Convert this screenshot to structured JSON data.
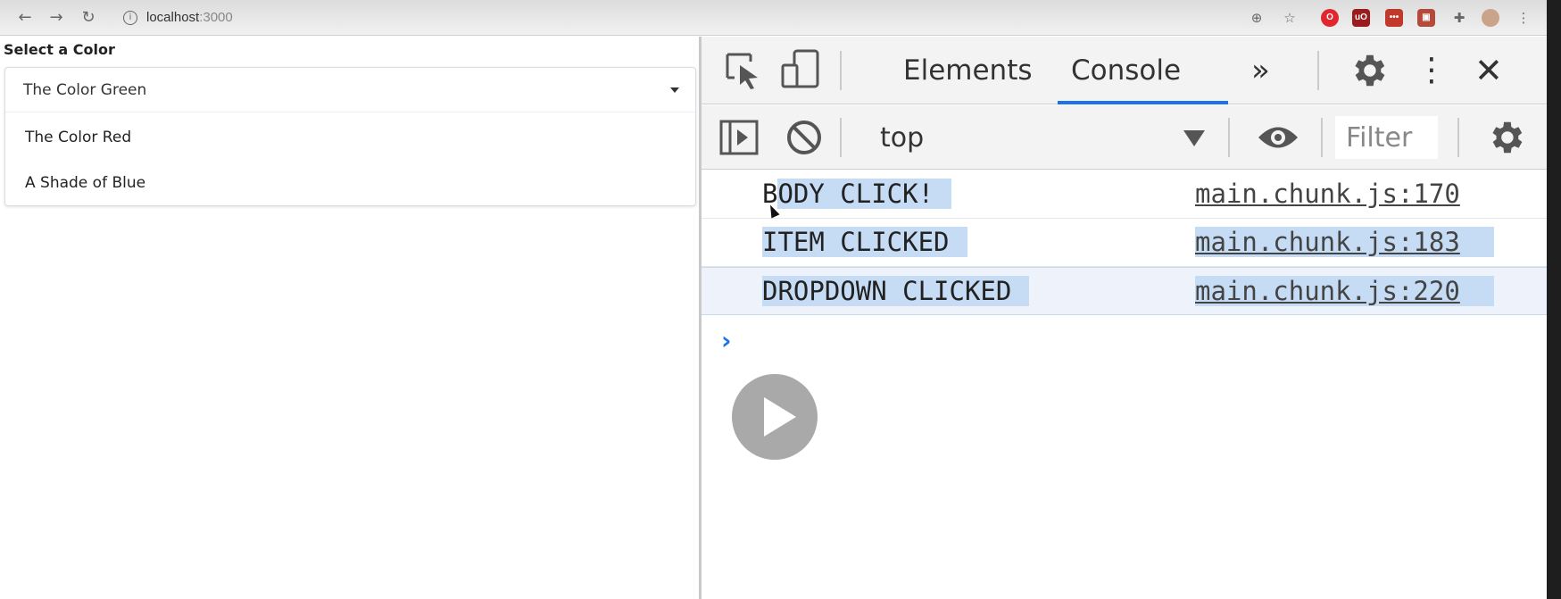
{
  "browser": {
    "back_icon": "arrow-left-icon",
    "forward_icon": "arrow-right-icon",
    "reload_icon": "reload-icon",
    "url_host": "localhost",
    "url_port": ":3000",
    "extensions": [
      "opera-icon",
      "ublock-icon",
      "ext-red-icon",
      "ext-photo-icon",
      "puzzle-icon",
      "avatar"
    ]
  },
  "app": {
    "label": "Select a Color",
    "dropdown": {
      "selected": "The Color Green",
      "options": [
        "The Color Red",
        "A Shade of Blue"
      ]
    }
  },
  "devtools": {
    "tabs": {
      "elements": "Elements",
      "console": "Console",
      "more": "»"
    },
    "active_tab": "Console",
    "toolbar": {
      "context": "top",
      "filter_placeholder": "Filter"
    },
    "console_logs": [
      {
        "message": "BODY CLICK!",
        "source": "main.chunk.js:170",
        "highlight_from": 1
      },
      {
        "message": "ITEM CLICKED",
        "source": "main.chunk.js:183"
      },
      {
        "message": "DROPDOWN CLICKED",
        "source": "main.chunk.js:220"
      }
    ],
    "prompt": "›"
  },
  "colors": {
    "accent": "#1a73e8",
    "selection": "#c6dcf5",
    "toolbar_bg": "#f3f3f3"
  }
}
